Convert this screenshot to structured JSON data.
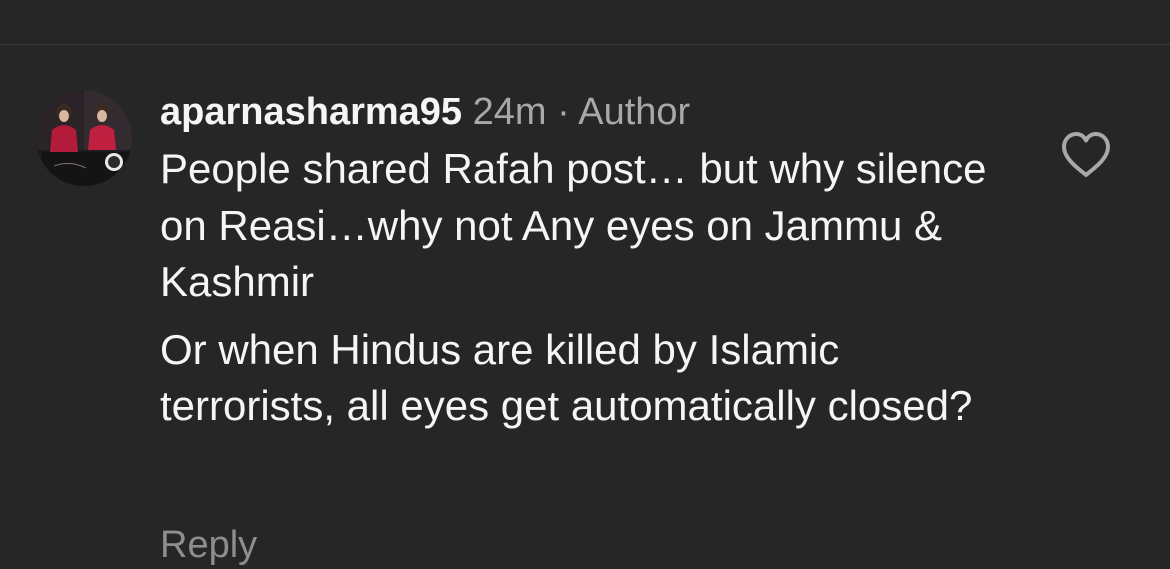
{
  "comment": {
    "username": "aparnasharma95",
    "time": "24m",
    "separator": "·",
    "role": "Author",
    "paragraphs": [
      "People shared Rafah post… but why silence on Reasi…why not Any eyes on Jammu & Kashmir",
      "Or when Hindus are killed by Islamic terrorists, all eyes get automatically closed?"
    ],
    "reply_label": "Reply"
  },
  "icons": {
    "like": "heart-outline-icon",
    "avatar": "profile-photo"
  },
  "colors": {
    "background": "#262626",
    "primary_text": "#f5f5f5",
    "secondary_text": "#a8a8a8",
    "reply_text": "#8e8e8e",
    "icon": "#a8a8a8"
  }
}
